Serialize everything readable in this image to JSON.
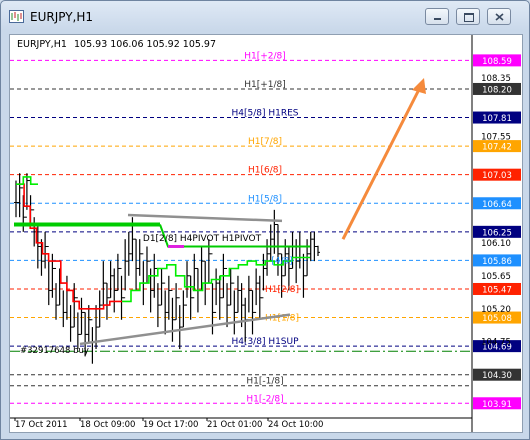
{
  "window": {
    "title": "EURJPY,H1",
    "minimize_label": "minimize",
    "maximize_label": "maximize",
    "close_label": "close"
  },
  "header": {
    "symbol": "EURJPY,H1",
    "ohlc": "105.93 106.06 105.92 105.97"
  },
  "annotation": {
    "order_text": "#32917648 buy"
  },
  "colors": {
    "candle": "#000000",
    "level_magenta": "#ff00ff",
    "level_dark": "#333333",
    "level_navy": "#000080",
    "level_orange": "#ffa500",
    "level_red": "#ff2200",
    "level_blue": "#1e90ff",
    "level_green": "#008000",
    "ma_red": "#ff0000",
    "ma_green": "#00ee00",
    "pivot_green": "#00cc00",
    "pivot_magenta": "#e020e0",
    "trendline": "#909090",
    "arrow": "#f58a3c"
  },
  "chart_data": {
    "type": "line",
    "title": "EURJPY,H1",
    "xlabel": "",
    "ylabel": "",
    "ylim": [
      103.75,
      108.8
    ],
    "x_tick_labels": [
      "17 Oct 2011",
      "18 Oct 09:00",
      "19 Oct 17:00",
      "21 Oct 01:00",
      "24 Oct 10:00"
    ],
    "y_tick_labels": [
      "108.35",
      "107.55",
      "106.10",
      "105.65",
      "105.20",
      "104.75"
    ],
    "levels": [
      {
        "label": "H1[+2/8]",
        "value": 108.59,
        "price": "108.59",
        "color": "#ff00ff",
        "dash": "4,3"
      },
      {
        "label": "H1[+1/8]",
        "value": 108.2,
        "price": "108.20",
        "color": "#333333",
        "dash": "4,3"
      },
      {
        "label": "H4[5/8] H1RES",
        "value": 107.81,
        "price": "107.81",
        "color": "#000080",
        "dash": "4,3"
      },
      {
        "label": "H1[7/8]",
        "value": 107.42,
        "price": "107.42",
        "color": "#ffa500",
        "dash": "4,3"
      },
      {
        "label": "H1[6/8]",
        "value": 107.03,
        "price": "107.03",
        "color": "#ff2200",
        "dash": "4,3"
      },
      {
        "label": "H1[5/8]",
        "value": 106.64,
        "price": "106.64",
        "color": "#1e90ff",
        "dash": "4,3"
      },
      {
        "label": "",
        "value": 106.25,
        "price": "106.25",
        "color": "#000080",
        "dash": "4,3"
      },
      {
        "label": "",
        "value": 105.86,
        "price": "105.86",
        "color": "#1e90ff",
        "dash": "4,3"
      },
      {
        "label": "",
        "value": 105.47,
        "price": "105.47",
        "color": "#ff2200",
        "dash": "4,3"
      },
      {
        "label": "",
        "value": 105.08,
        "price": "105.08",
        "color": "#ffa500",
        "dash": "4,3"
      },
      {
        "label": "H4[3/8] H1SUP",
        "value": 104.69,
        "price": "104.69",
        "color": "#000080",
        "dash": "4,3"
      },
      {
        "label": "",
        "value": 104.62,
        "price": "",
        "color": "#008000",
        "dash": "10,3,2,3"
      },
      {
        "label": "",
        "value": 104.3,
        "price": "104.30",
        "color": "#333333",
        "dash": "4,3"
      },
      {
        "label": "H1[-1/8]",
        "value": 104.15,
        "price": "",
        "color": "#333333",
        "dash": "4,3"
      },
      {
        "label": "H1[-2/8]",
        "value": 103.91,
        "price": "103.91",
        "color": "#ff00ff",
        "dash": "4,3"
      }
    ],
    "inline_labels": [
      "H1[2/8]",
      "H1[1/8]",
      "D1[2/8] H4PIVOT H1PIVOT",
      "[4/8]"
    ],
    "series": [
      {
        "name": "",
        "kind": "candles",
        "closes": [
          106.65,
          106.85,
          106.45,
          106.95,
          106.55,
          106.25,
          106.05,
          105.85,
          106.05,
          105.45,
          105.75,
          105.25,
          105.55,
          105.15,
          105.45,
          104.95,
          105.35,
          104.85,
          105.15,
          104.85,
          105.05,
          104.75,
          104.95,
          105.25,
          105.55,
          105.35,
          105.65,
          105.45,
          105.75,
          105.35,
          105.85,
          105.95,
          106.15,
          105.75,
          105.95,
          105.55,
          105.85,
          105.45,
          105.75,
          105.25,
          105.55,
          105.15,
          105.45,
          105.05,
          105.35,
          104.95,
          105.25,
          105.65,
          105.35,
          105.75,
          105.45,
          105.85,
          105.55,
          105.95,
          105.15,
          105.55,
          105.35,
          105.75,
          105.25,
          105.55,
          105.15,
          105.45,
          105.25,
          105.05,
          105.45,
          105.15,
          105.55,
          105.35,
          105.75,
          105.95,
          106.15,
          106.35,
          105.95,
          105.65,
          105.95,
          105.75,
          106.05,
          105.85,
          106.05,
          105.65,
          105.95,
          106.15,
          106.05,
          105.97
        ],
        "highs": [
          106.95,
          107.05,
          106.75,
          107.05,
          106.75,
          106.45,
          106.35,
          106.15,
          106.25,
          105.85,
          105.95,
          105.55,
          105.75,
          105.45,
          105.65,
          105.25,
          105.55,
          105.15,
          105.35,
          105.15,
          105.25,
          104.95,
          105.25,
          105.45,
          105.85,
          105.55,
          105.85,
          105.75,
          105.95,
          105.65,
          106.15,
          106.25,
          106.45,
          106.15,
          106.15,
          105.85,
          106.05,
          105.75,
          105.95,
          105.55,
          105.75,
          105.45,
          105.65,
          105.35,
          105.55,
          105.25,
          105.45,
          105.85,
          105.65,
          105.95,
          105.75,
          106.05,
          105.85,
          106.15,
          105.55,
          105.75,
          105.65,
          105.95,
          105.55,
          105.75,
          105.45,
          105.65,
          105.55,
          105.35,
          105.65,
          105.45,
          105.75,
          105.65,
          105.95,
          106.15,
          106.35,
          106.55,
          106.35,
          105.95,
          106.15,
          106.05,
          106.25,
          106.15,
          106.25,
          105.95,
          106.15,
          106.25,
          106.25,
          106.06
        ],
        "lows": [
          106.45,
          106.45,
          106.25,
          106.55,
          106.35,
          106.05,
          105.75,
          105.65,
          105.75,
          105.25,
          105.35,
          105.05,
          105.25,
          104.95,
          105.05,
          104.75,
          104.95,
          104.65,
          104.85,
          104.55,
          104.75,
          104.45,
          104.65,
          104.95,
          105.25,
          105.05,
          105.35,
          105.15,
          105.45,
          105.05,
          105.45,
          105.65,
          105.85,
          105.45,
          105.65,
          105.25,
          105.55,
          105.15,
          105.35,
          104.95,
          105.25,
          104.85,
          105.05,
          104.75,
          105.05,
          104.65,
          104.95,
          105.35,
          105.05,
          105.45,
          105.15,
          105.45,
          105.25,
          105.55,
          104.85,
          105.25,
          105.05,
          105.35,
          104.95,
          105.25,
          104.85,
          105.15,
          104.95,
          104.75,
          105.15,
          104.85,
          105.25,
          105.05,
          105.45,
          105.65,
          105.85,
          105.95,
          105.65,
          105.35,
          105.65,
          105.45,
          105.75,
          105.55,
          105.75,
          105.35,
          105.65,
          105.85,
          105.85,
          105.92
        ]
      }
    ],
    "ma_red_values": [
      106.9,
      106.6,
      106.3,
      106.1,
      105.95,
      105.85,
      105.85,
      105.55,
      105.45,
      105.3,
      105.2,
      105.2,
      105.2,
      105.2,
      105.25,
      105.3,
      105.3
    ],
    "ma_green_values": [
      106.9,
      107.0,
      106.9
    ],
    "ma_green2_values": [
      105.3,
      105.45,
      105.55,
      105.65,
      105.75,
      105.8,
      105.65,
      105.5,
      105.45,
      105.55,
      105.6,
      105.65,
      105.75,
      105.8,
      105.85,
      105.8,
      105.85,
      105.8,
      105.85,
      105.9,
      105.9
    ],
    "pivot_green_values": [
      106.35,
      106.35,
      106.05
    ],
    "pivot_magenta_values": [
      106.05,
      106.05
    ]
  }
}
